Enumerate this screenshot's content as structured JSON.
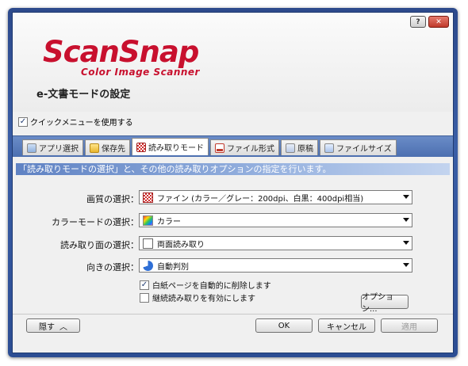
{
  "window": {
    "help_label": "?",
    "close_label": "✕"
  },
  "logo": {
    "main": "ScanSnap",
    "sub": "Color Image Scanner"
  },
  "page_title": "e-文書モードの設定",
  "quick_menu": {
    "label": "クイックメニューを使用する",
    "checked": true
  },
  "tabs": [
    {
      "label": "アプリ選択",
      "icon": "app-icon"
    },
    {
      "label": "保存先",
      "icon": "folder-icon"
    },
    {
      "label": "読み取りモード",
      "icon": "scan-mode-icon",
      "active": true
    },
    {
      "label": "ファイル形式",
      "icon": "pdf-icon"
    },
    {
      "label": "原稿",
      "icon": "document-icon"
    },
    {
      "label": "ファイルサイズ",
      "icon": "file-size-icon"
    }
  ],
  "banner": "「読み取りモードの選択」と、その他の読み取りオプションの指定を行います。",
  "settings": {
    "quality": {
      "label": "画質の選択：",
      "value": "ファイン (カラー／グレー：200dpi、白黒：400dpi相当)"
    },
    "color": {
      "label": "カラーモードの選択：",
      "value": "カラー"
    },
    "side": {
      "label": "読み取り面の選択：",
      "value": "両面読み取り"
    },
    "orientation": {
      "label": "向きの選択：",
      "value": "自動判別"
    }
  },
  "options": [
    {
      "label": "白紙ページを自動的に削除します",
      "checked": true
    },
    {
      "label": "継続読み取りを有効にします",
      "checked": false
    }
  ],
  "buttons": {
    "option": "オプション...",
    "hide": "隠す",
    "ok": "OK",
    "cancel": "キャンセル",
    "apply": "適用"
  }
}
